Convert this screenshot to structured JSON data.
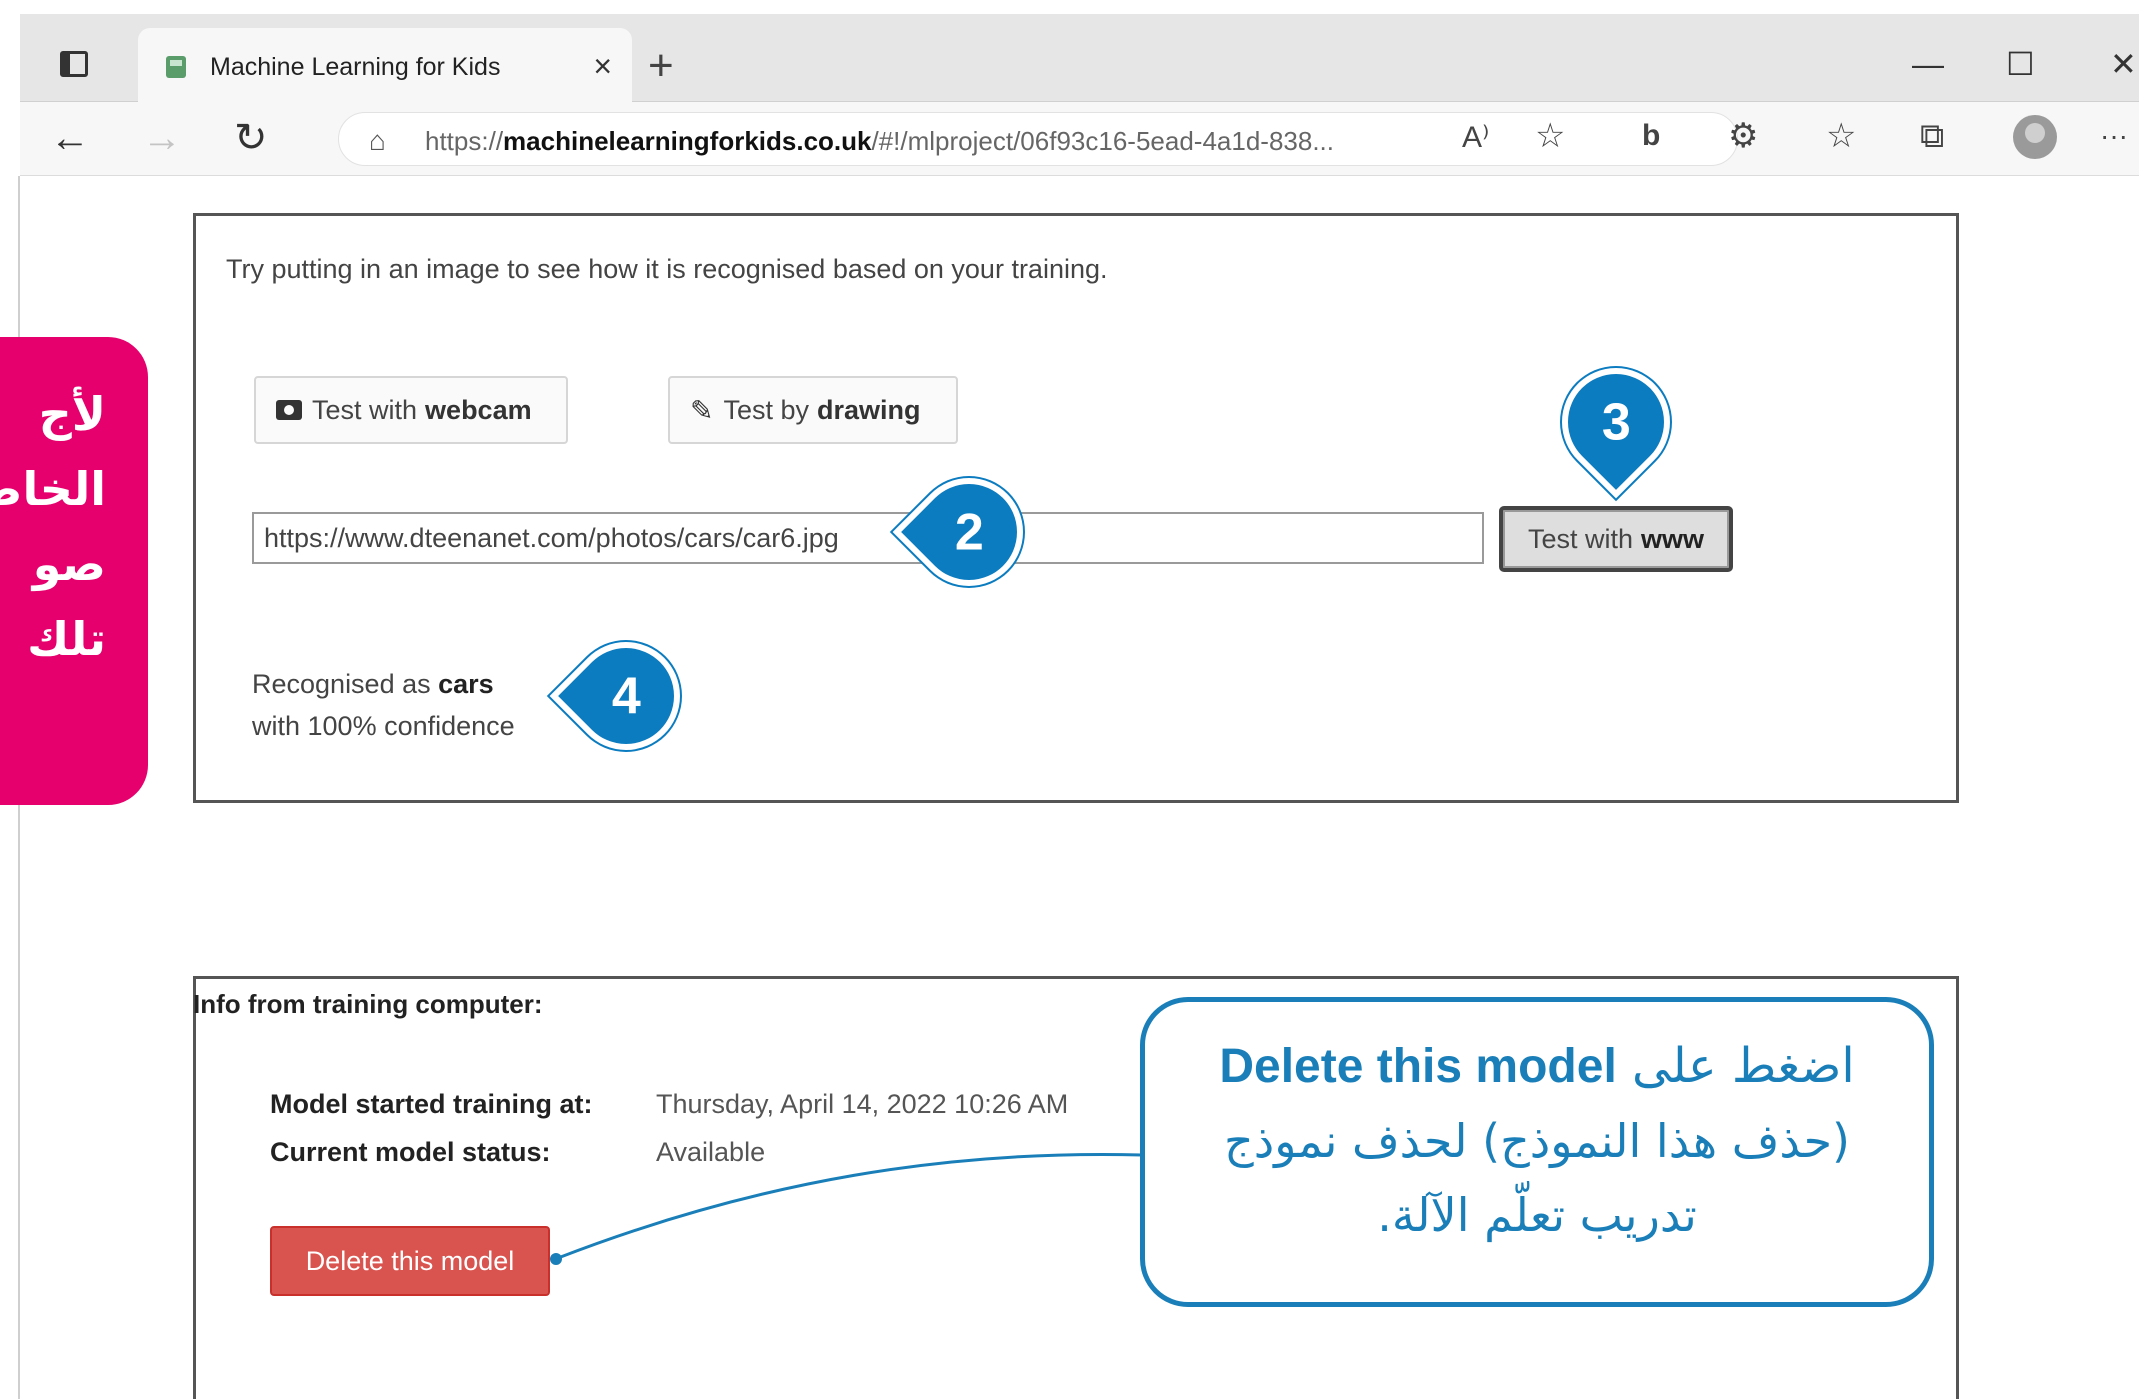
{
  "browser": {
    "tab_title": "Machine Learning for Kids",
    "tab_close": "×",
    "new_tab": "+",
    "minimize": "—",
    "maximize": "☐",
    "close": "✕",
    "url_prefix": "https://",
    "url_domain": "machinelearningforkids.co.uk",
    "url_path": "/#!/mlproject/06f93c16-5ead-4a1d-838...",
    "read_aloud": "A⁾",
    "favorites_add": "☆",
    "bing": "b",
    "extensions": "⚙",
    "favorites": "☆",
    "collections": "⧉",
    "more": "···"
  },
  "test_panel": {
    "intro": "Try putting in an image to see how it is recognised based on your training.",
    "webcam_prefix": "Test with",
    "webcam_bold": "webcam",
    "drawing_prefix": "Test by",
    "drawing_bold": "drawing",
    "url_value": "https://www.dteenanet.com/photos/cars/car6.jpg",
    "www_prefix": "Test with",
    "www_bold": "www",
    "result_prefix": "Recognised as",
    "result_label": "cars",
    "result_confidence": "with 100% confidence"
  },
  "markers": {
    "m2": "2",
    "m3": "3",
    "m4": "4"
  },
  "side_note": {
    "lines": [
      "لأج",
      "الخاص",
      "صو",
      "تلك"
    ]
  },
  "info_panel": {
    "title": "Info from training computer:",
    "started_label": "Model started training at:",
    "started_value": "Thursday, April 14, 2022 10:26 AM",
    "status_label": "Current model status:",
    "status_value": "Available",
    "delete_button": "Delete this model"
  },
  "annotation": {
    "line1_en": "Delete this model",
    "line1_ar": "اضغط على",
    "line2": "(حذف هذا النموذج) لحذف نموذج",
    "line3": "تدريب تعلّم الآلة."
  },
  "colors": {
    "marker_blue": "#0c7cc0",
    "pink": "#e5006d",
    "delete_red": "#d9534f",
    "annotation_blue": "#1a7fb8"
  }
}
